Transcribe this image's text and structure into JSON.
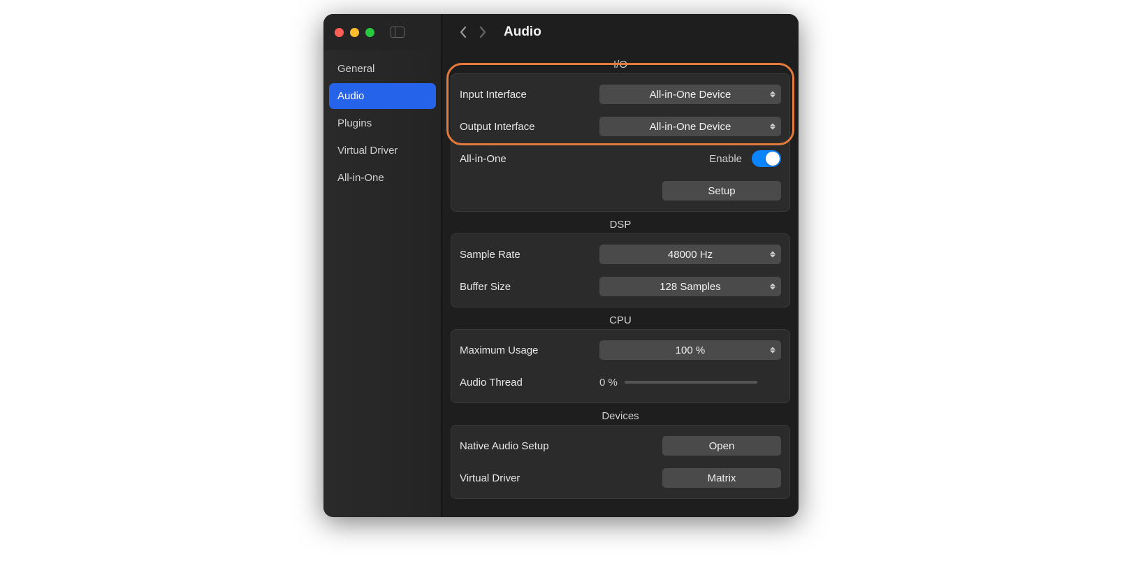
{
  "header": {
    "title": "Audio"
  },
  "sidebar": {
    "items": [
      {
        "label": "General"
      },
      {
        "label": "Audio"
      },
      {
        "label": "Plugins"
      },
      {
        "label": "Virtual Driver"
      },
      {
        "label": "All-in-One"
      }
    ],
    "activeIndex": 1
  },
  "sections": {
    "io": {
      "title": "I/O",
      "input_label": "Input Interface",
      "input_value": "All-in-One Device",
      "output_label": "Output Interface",
      "output_value": "All-in-One Device",
      "aio_label": "All-in-One",
      "aio_enable_text": "Enable",
      "aio_enabled": true,
      "setup_label": "Setup"
    },
    "dsp": {
      "title": "DSP",
      "sample_rate_label": "Sample Rate",
      "sample_rate_value": "48000 Hz",
      "buffer_size_label": "Buffer Size",
      "buffer_size_value": "128 Samples"
    },
    "cpu": {
      "title": "CPU",
      "max_usage_label": "Maximum Usage",
      "max_usage_value": "100 %",
      "audio_thread_label": "Audio Thread",
      "audio_thread_value": "0 %"
    },
    "devices": {
      "title": "Devices",
      "native_setup_label": "Native Audio Setup",
      "native_setup_button": "Open",
      "virtual_driver_label": "Virtual Driver",
      "virtual_driver_button": "Matrix"
    }
  },
  "highlight": {
    "color": "#e67a3c"
  }
}
